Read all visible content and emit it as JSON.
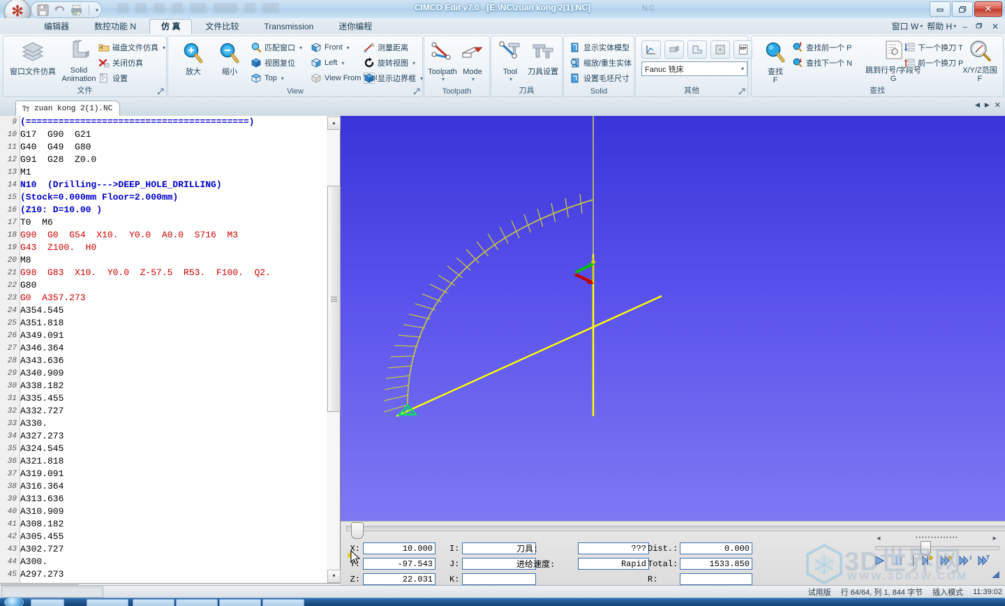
{
  "window": {
    "title": "CIMCO Edit v7.0 - [E:\\NC\\zuan kong 2(1).NC]",
    "ghost_title": "NC",
    "minimize": "—",
    "restore": "❐",
    "close": "✕"
  },
  "quick_access": {
    "save": "save-icon",
    "undo": "undo-icon",
    "print": "print-icon",
    "more": "▾"
  },
  "tabs": [
    {
      "label": "编辑器",
      "active": false
    },
    {
      "label": "数控功能 N",
      "active": false
    },
    {
      "label": "仿 真",
      "active": true
    },
    {
      "label": "文件比较",
      "active": false
    },
    {
      "label": "Transmission",
      "active": false
    },
    {
      "label": "迷你编程",
      "active": false
    }
  ],
  "menu_right": {
    "window": "窗口 W",
    "help": "帮助 H",
    "minimize": "–",
    "restore": "❐",
    "close": "✕"
  },
  "ribbon": {
    "groups": [
      {
        "name": "文件",
        "big": [
          {
            "label": "窗口文件仿真",
            "icon": "layers-icon"
          },
          {
            "label": "Solid\nAnimation",
            "icon": "solid-animation-icon"
          }
        ],
        "small": [
          {
            "label": "磁盘文件仿真",
            "icon": "folder-sim-icon",
            "dropdown": true
          },
          {
            "label": "关闭仿真",
            "icon": "close-sim-icon",
            "dropdown": false
          },
          {
            "label": "设置",
            "icon": "settings-icon",
            "dropdown": false
          }
        ]
      },
      {
        "name": "View",
        "big": [
          {
            "label": "放大",
            "icon": "zoom-in-icon"
          },
          {
            "label": "缩小",
            "icon": "zoom-out-icon"
          }
        ],
        "small": [
          {
            "label": "匹配窗口",
            "icon": "fit-window-icon",
            "dropdown": true
          },
          {
            "label": "视图复位",
            "icon": "reset-view-icon",
            "dropdown": false
          },
          {
            "label": "Top",
            "icon": "top-view-icon",
            "dropdown": true
          },
          {
            "label": "Front",
            "icon": "front-view-icon",
            "dropdown": true
          },
          {
            "label": "Left",
            "icon": "left-view-icon",
            "dropdown": true
          },
          {
            "label": "View From Tool",
            "icon": "view-from-tool-icon",
            "dropdown": false
          },
          {
            "label": "测量距离",
            "icon": "measure-icon",
            "dropdown": false
          },
          {
            "label": "旋转视图",
            "icon": "rotate-view-icon",
            "dropdown": true
          },
          {
            "label": "显示边界框",
            "icon": "bounding-box-icon",
            "dropdown": true
          }
        ]
      },
      {
        "name": "Toolpath",
        "big": [
          {
            "label": "Toolpath",
            "icon": "toolpath-icon"
          },
          {
            "label": "Mode",
            "icon": "mode-icon"
          }
        ],
        "small": []
      },
      {
        "name": "刀具",
        "big": [
          {
            "label": "Tool",
            "icon": "tool-icon"
          },
          {
            "label": "刀具设置",
            "icon": "tool-settings-icon"
          }
        ],
        "small": []
      },
      {
        "name": "Solid",
        "big": [],
        "small": [
          {
            "label": "显示实体模型",
            "icon": "show-solid-icon",
            "dropdown": false
          },
          {
            "label": "缩放/重生实体",
            "icon": "zoom-regen-icon",
            "dropdown": false
          },
          {
            "label": "设置毛坯尺寸",
            "icon": "stock-size-icon",
            "dropdown": false
          }
        ]
      },
      {
        "name": "其他",
        "big": [],
        "small": [],
        "icon_buttons": [
          "plot-icon",
          "render-icon",
          "profile-icon",
          "mesh-icon",
          "dxf-icon"
        ],
        "combo": {
          "value": "Fanuc 铣床",
          "caret": "▾"
        }
      },
      {
        "name": "查找",
        "big": [
          {
            "label": "查找\nF",
            "icon": "find-icon"
          },
          {
            "label": "跳到行号/字段号\nG",
            "icon": "goto-line-icon"
          },
          {
            "label": "X/Y/Z范围\nF",
            "icon": "xyz-range-icon"
          }
        ],
        "small": [
          {
            "label": "查找前一个 P",
            "icon": "find-prev-icon",
            "dropdown": false
          },
          {
            "label": "查找下一个 N",
            "icon": "find-next-icon",
            "dropdown": false
          },
          {
            "label": "下一个换刀 T",
            "icon": "next-tool-change-icon",
            "dropdown": false
          },
          {
            "label": "前一个换刀 P",
            "icon": "prev-tool-change-icon",
            "dropdown": false
          }
        ]
      }
    ]
  },
  "document_tab": {
    "label": "zuan kong 2(1).NC",
    "icon": "nc-file-icon"
  },
  "mdi_controls": {
    "prev": "◀",
    "next": "▶",
    "close": "✕"
  },
  "editor": {
    "lines": [
      {
        "n": 9,
        "text": "(=========================================)",
        "color": "blue"
      },
      {
        "n": 10,
        "text": "G17  G90  G21",
        "color": "black"
      },
      {
        "n": 11,
        "text": "G40  G49  G80",
        "color": "black"
      },
      {
        "n": 12,
        "text": "G91  G28  Z0.0",
        "color": "black"
      },
      {
        "n": 13,
        "text": "M1",
        "color": "black"
      },
      {
        "n": 14,
        "text": "N10  (Drilling--->DEEP_HOLE_DRILLING)",
        "color": "blue"
      },
      {
        "n": 15,
        "text": "(Stock=0.000mm Floor=2.000mm)",
        "color": "blue"
      },
      {
        "n": 16,
        "text": "(Z10: D=10.00 )",
        "color": "blue"
      },
      {
        "n": 17,
        "text": "T0  M6",
        "color": "black"
      },
      {
        "n": 18,
        "text": "G90  G0  G54  X10.  Y0.0  A0.0  S716  M3",
        "color": "red"
      },
      {
        "n": 19,
        "text": "G43  Z100.  H0",
        "color": "red"
      },
      {
        "n": 20,
        "text": "M8",
        "color": "black"
      },
      {
        "n": 21,
        "text": "G98  G83  X10.  Y0.0  Z-57.5  R53.  F100.  Q2.",
        "color": "red"
      },
      {
        "n": 22,
        "text": "G80",
        "color": "black"
      },
      {
        "n": 23,
        "text": "G0  A357.273",
        "color": "red"
      },
      {
        "n": 24,
        "text": "A354.545",
        "color": "black"
      },
      {
        "n": 25,
        "text": "A351.818",
        "color": "black"
      },
      {
        "n": 26,
        "text": "A349.091",
        "color": "black"
      },
      {
        "n": 27,
        "text": "A346.364",
        "color": "black"
      },
      {
        "n": 28,
        "text": "A343.636",
        "color": "black"
      },
      {
        "n": 29,
        "text": "A340.909",
        "color": "black"
      },
      {
        "n": 30,
        "text": "A338.182",
        "color": "black"
      },
      {
        "n": 31,
        "text": "A335.455",
        "color": "black"
      },
      {
        "n": 32,
        "text": "A332.727",
        "color": "black"
      },
      {
        "n": 33,
        "text": "A330.",
        "color": "black"
      },
      {
        "n": 34,
        "text": "A327.273",
        "color": "black"
      },
      {
        "n": 35,
        "text": "A324.545",
        "color": "black"
      },
      {
        "n": 36,
        "text": "A321.818",
        "color": "black"
      },
      {
        "n": 37,
        "text": "A319.091",
        "color": "black"
      },
      {
        "n": 38,
        "text": "A316.364",
        "color": "black"
      },
      {
        "n": 39,
        "text": "A313.636",
        "color": "black"
      },
      {
        "n": 40,
        "text": "A310.909",
        "color": "black"
      },
      {
        "n": 41,
        "text": "A308.182",
        "color": "black"
      },
      {
        "n": 42,
        "text": "A305.455",
        "color": "black"
      },
      {
        "n": 43,
        "text": "A302.727",
        "color": "black"
      },
      {
        "n": 44,
        "text": "A300.",
        "color": "black"
      },
      {
        "n": 45,
        "text": "A297.273",
        "color": "black"
      }
    ]
  },
  "sim_panel": {
    "fields": [
      {
        "label": "X:",
        "value": "10.000"
      },
      {
        "label": "Y:",
        "value": "-97.543"
      },
      {
        "label": "Z:",
        "value": "22.031"
      },
      {
        "label": "I:",
        "value": ""
      },
      {
        "label": "J:",
        "value": ""
      },
      {
        "label": "K:",
        "value": ""
      },
      {
        "label": "刀具:",
        "value": "???"
      },
      {
        "label": "进给速度:",
        "value": "Rapid"
      },
      {
        "label": "Dist.:",
        "value": "0.000"
      },
      {
        "label": "Total:",
        "value": "1533.850"
      },
      {
        "label": "R:",
        "value": ""
      }
    ]
  },
  "playback": {
    "buttons": [
      {
        "name": "play-button",
        "glyph": "▶"
      },
      {
        "name": "pause-button",
        "glyph": "‖"
      },
      {
        "name": "step-block-button",
        "glyph": "▶"
      },
      {
        "name": "step-tool-button",
        "glyph": "▶"
      },
      {
        "name": "step-z-button",
        "glyph": "▶"
      },
      {
        "name": "step-toolchange-button",
        "glyph": "▶"
      }
    ]
  },
  "watermark": {
    "main": "3D世界网",
    "sub": "WWW.3D8JW.COM"
  },
  "statusbar": {
    "license": "试用版",
    "position": "行 64/64, 列 1, 844 字节",
    "mode": "插入模式",
    "time": "11:39:02"
  },
  "colors": {
    "viewport_top": "#3a34d8",
    "viewport_bottom": "#7e79f2",
    "toolpath": "#c8c832",
    "axis": "#ffff00",
    "origin": "#00d050",
    "code_blue": "#0000cc",
    "code_red": "#cc0000",
    "titlebar": "#bfd9ef"
  }
}
